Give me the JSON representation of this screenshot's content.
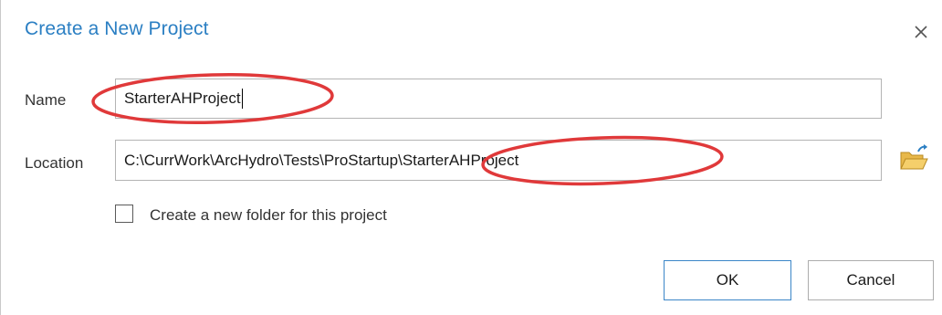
{
  "dialog": {
    "title": "Create a New Project",
    "close_icon": "close-icon"
  },
  "form": {
    "name_label": "Name",
    "name_value": "StarterAHProject",
    "location_label": "Location",
    "location_value": "C:\\CurrWork\\ArcHydro\\Tests\\ProStartup\\StarterAHProject",
    "browse_icon": "folder-open-icon",
    "new_folder_label": "Create a new folder for this project",
    "new_folder_checked": false
  },
  "buttons": {
    "ok_label": "OK",
    "cancel_label": "Cancel"
  },
  "annotations": {
    "highlight_color": "#e0393a"
  },
  "colors": {
    "title": "#2b7fc3",
    "ok_border": "#3b86c8"
  }
}
